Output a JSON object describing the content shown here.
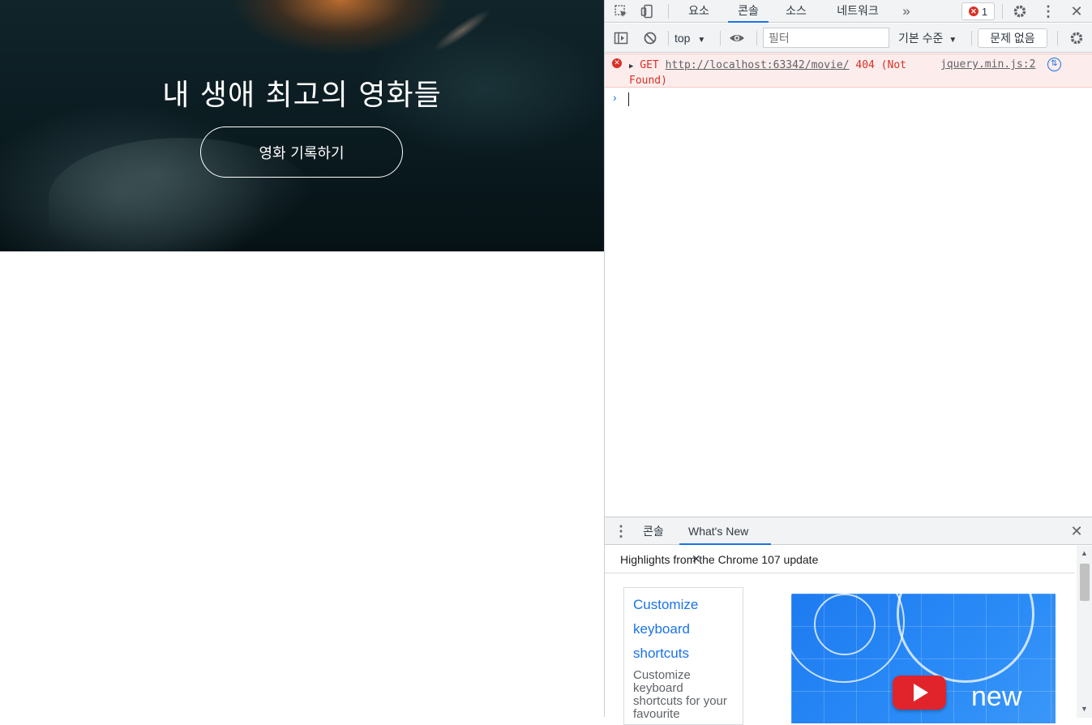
{
  "page": {
    "hero": {
      "title": "내 생애 최고의 영화들",
      "button_label": "영화 기록하기"
    }
  },
  "devtools": {
    "tabs": [
      {
        "label": "요소",
        "active": false
      },
      {
        "label": "콘솔",
        "active": true
      },
      {
        "label": "소스",
        "active": false
      },
      {
        "label": "네트워크",
        "active": false
      }
    ],
    "more_tabs_icon": "double-chevron-right-icon",
    "error_count": "1",
    "toolbar": {
      "context": "top",
      "filter_placeholder": "필터",
      "levels": "기본 수준",
      "issues": "문제 없음"
    },
    "console": {
      "entries": [
        {
          "level": "error",
          "method": "GET",
          "url": "http://localhost:63342/movie/",
          "status": "404 (Not",
          "status_cont": "Found)",
          "source": "jquery.min.js:2"
        }
      ],
      "prompt": "›"
    },
    "drawer": {
      "tabs": [
        {
          "label": "콘솔",
          "active": false
        },
        {
          "label": "What's New",
          "active": true
        }
      ],
      "heading": "Highlights from the Chrome 107 update",
      "card": {
        "title": "Customize keyboard shortcuts",
        "description": "Customize keyboard shortcuts for your favourite"
      },
      "video_label": "new"
    },
    "colors": {
      "accent": "#1a73e8",
      "error": "#d93025",
      "error_bg": "#fcedec"
    }
  }
}
